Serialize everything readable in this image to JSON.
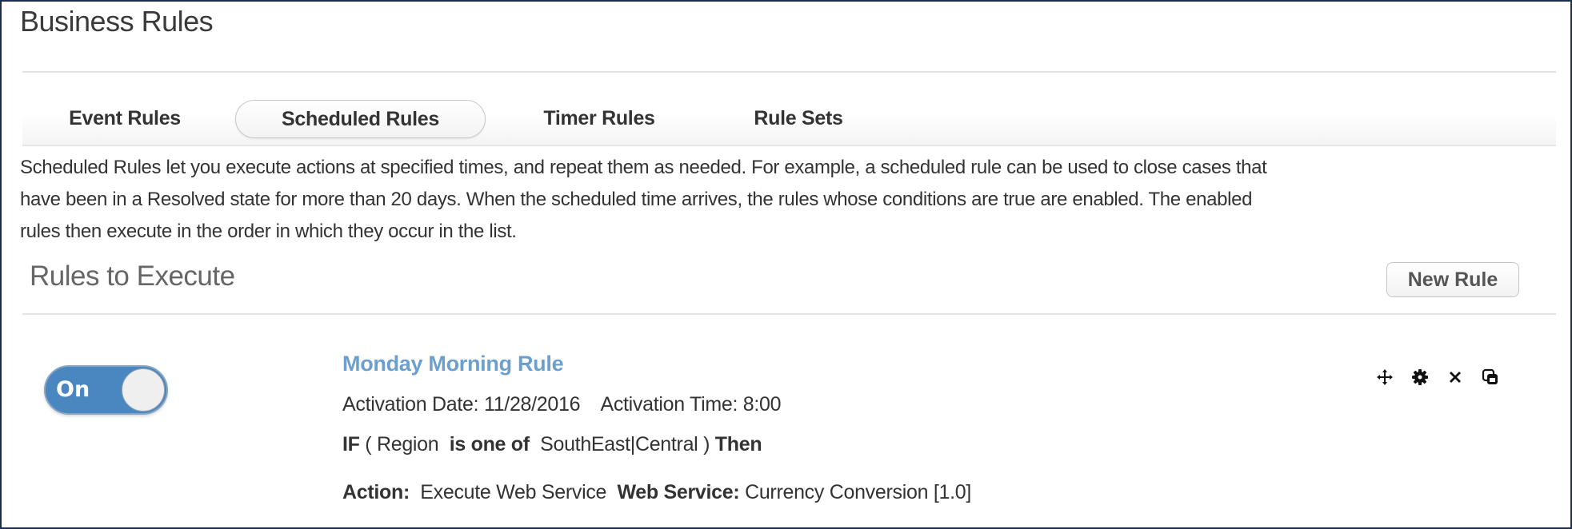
{
  "page": {
    "title": "Business Rules"
  },
  "tabs": [
    {
      "label": "Event Rules",
      "active": false
    },
    {
      "label": "Scheduled Rules",
      "active": true
    },
    {
      "label": "Timer Rules",
      "active": false
    },
    {
      "label": "Rule Sets",
      "active": false
    }
  ],
  "description": {
    "line1": "Scheduled Rules let you execute actions at specified times, and repeat them as needed. For example, a scheduled rule can be used to close cases that",
    "line2": "have been in a Resolved state for more than 20 days. When the scheduled time arrives, the rules whose conditions are true are enabled. The enabled",
    "line3": "rules then execute in the order in which they occur in the list."
  },
  "section": {
    "title": "Rules to Execute",
    "new_rule_label": "New Rule"
  },
  "rules": [
    {
      "toggle": {
        "label": "On",
        "state": "on",
        "color": "#4a86c0"
      },
      "name": "Monday Morning Rule",
      "activation_date_label": "Activation Date:",
      "activation_date": "11/28/2016",
      "activation_time_label": "Activation Time:",
      "activation_time": "8:00",
      "condition": {
        "if_label": "IF",
        "open_paren": "(",
        "field": "Region",
        "operator": "is one of",
        "values": "SouthEast|Central",
        "close_paren": ")",
        "then_label": "Then"
      },
      "action": {
        "action_label": "Action:",
        "action_value": "Execute Web Service",
        "web_service_label": "Web Service:",
        "web_service_value": "Currency Conversion [1.0]"
      },
      "actions_icons": [
        "move-icon",
        "gear-icon",
        "delete-icon",
        "copy-icon"
      ]
    }
  ],
  "colors": {
    "link": "#6c9fcd",
    "toggle_on": "#4a86c0",
    "frame_border": "#1b2e4f"
  }
}
